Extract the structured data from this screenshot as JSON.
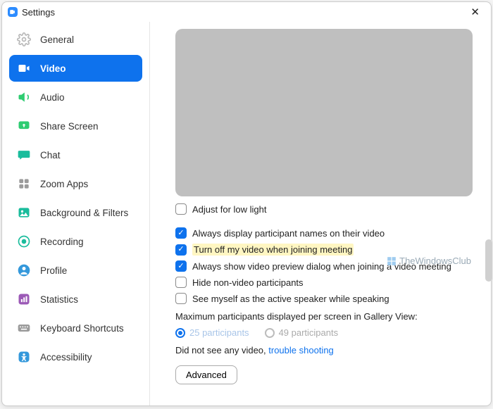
{
  "window": {
    "title": "Settings"
  },
  "sidebar": {
    "items": [
      {
        "label": "General"
      },
      {
        "label": "Video"
      },
      {
        "label": "Audio"
      },
      {
        "label": "Share Screen"
      },
      {
        "label": "Chat"
      },
      {
        "label": "Zoom Apps"
      },
      {
        "label": "Background & Filters"
      },
      {
        "label": "Recording"
      },
      {
        "label": "Profile"
      },
      {
        "label": "Statistics"
      },
      {
        "label": "Keyboard Shortcuts"
      },
      {
        "label": "Accessibility"
      }
    ]
  },
  "video": {
    "adjust_low_light": "Adjust for low light",
    "opt1": "Always display participant names on their video",
    "opt2": "Turn off my video when joining meeting",
    "opt3": "Always show video preview dialog when joining a video meeting",
    "opt4": "Hide non-video participants",
    "opt5": "See myself as the active speaker while speaking",
    "gallery_label": "Maximum participants displayed per screen in Gallery View:",
    "radio1": "25 participants",
    "radio2": "49 participants",
    "novideo_text": "Did not see any video,",
    "trouble_link": "trouble shooting",
    "advanced": "Advanced"
  },
  "watermark": "TheWindowsClub"
}
